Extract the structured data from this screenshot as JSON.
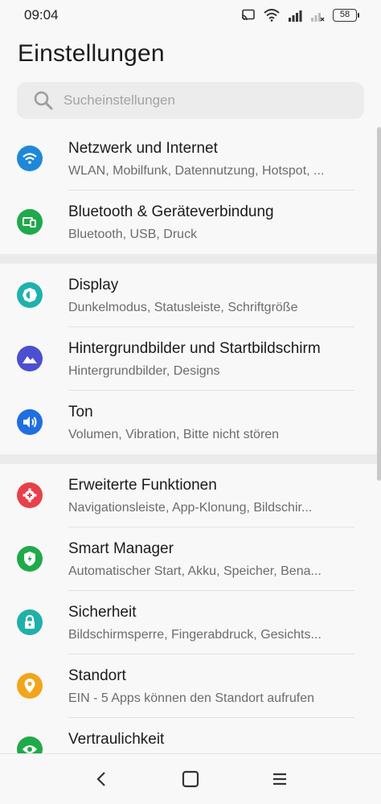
{
  "status": {
    "time": "09:04",
    "battery": "58"
  },
  "header": {
    "title": "Einstellungen"
  },
  "search": {
    "placeholder": "Sucheinstellungen"
  },
  "groups": [
    {
      "items": [
        {
          "title": "Netzwerk und Internet",
          "subtitle": "WLAN, Mobilfunk, Datennutzung, Hotspot, ...",
          "icon": "wifi-icon",
          "color": "#1e88d8"
        },
        {
          "title": "Bluetooth & Geräteverbindung",
          "subtitle": "Bluetooth, USB, Druck",
          "icon": "devices-icon",
          "color": "#1fa94b"
        }
      ]
    },
    {
      "items": [
        {
          "title": "Display",
          "subtitle": "Dunkelmodus, Statusleiste, Schriftgröße",
          "icon": "brightness-icon",
          "color": "#1eb2ac"
        },
        {
          "title": "Hintergrundbilder und Startbildschirm",
          "subtitle": "Hintergrundbilder, Designs",
          "icon": "wallpaper-icon",
          "color": "#4c4fd0"
        },
        {
          "title": "Ton",
          "subtitle": "Volumen, Vibration, Bitte nicht stören",
          "icon": "volume-icon",
          "color": "#1f6fe0"
        }
      ]
    },
    {
      "items": [
        {
          "title": "Erweiterte Funktionen",
          "subtitle": "Navigationsleiste, App-Klonung, Bildschir...",
          "icon": "gear-plus-icon",
          "color": "#e8404a"
        },
        {
          "title": "Smart Manager",
          "subtitle": "Automatischer Start, Akku, Speicher, Bena...",
          "icon": "shield-icon",
          "color": "#1faa4a"
        },
        {
          "title": "Sicherheit",
          "subtitle": "Bildschirmsperre, Fingerabdruck, Gesichts...",
          "icon": "lock-icon",
          "color": "#1fb1a8"
        },
        {
          "title": "Standort",
          "subtitle": "EIN - 5 Apps können den Standort aufrufen",
          "icon": "location-icon",
          "color": "#f1a51b"
        },
        {
          "title": "Vertraulichkeit",
          "subtitle": "",
          "icon": "privacy-icon",
          "color": "#1faa4a"
        }
      ]
    }
  ]
}
